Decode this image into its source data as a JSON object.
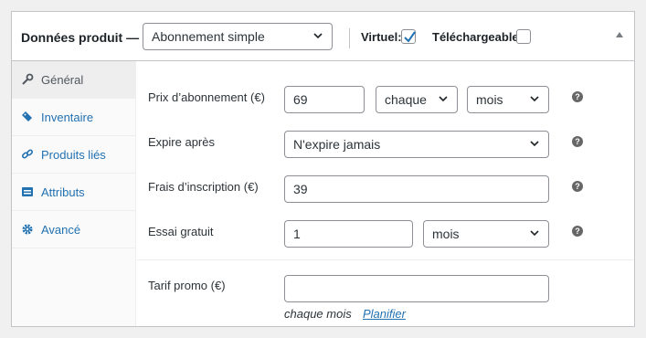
{
  "header": {
    "title": "Données produit —",
    "product_type": "Abonnement simple",
    "virtual_label": "Virtuel:",
    "virtual_checked": true,
    "downloadable_label": "Téléchargeable:",
    "downloadable_checked": false,
    "toggle_icon": "triangle-up-icon"
  },
  "tabs": [
    {
      "label": "Général",
      "icon": "wrench-icon",
      "active": true
    },
    {
      "label": "Inventaire",
      "icon": "tag-icon",
      "active": false
    },
    {
      "label": "Produits liés",
      "icon": "link-icon",
      "active": false
    },
    {
      "label": "Attributs",
      "icon": "list-icon",
      "active": false
    },
    {
      "label": "Avancé",
      "icon": "gear-icon",
      "active": false
    }
  ],
  "fields": {
    "subscription_price": {
      "label": "Prix d’abonnement (€)",
      "value": "69",
      "interval": "chaque",
      "period": "mois"
    },
    "expire": {
      "label": "Expire après",
      "value": "N'expire jamais"
    },
    "signup_fee": {
      "label": "Frais d’inscription (€)",
      "value": "39"
    },
    "trial": {
      "label": "Essai gratuit",
      "value": "1",
      "period": "mois"
    },
    "sale_price": {
      "label": "Tarif promo (€)",
      "value": "",
      "hint": "chaque mois",
      "schedule_link": "Planifier"
    }
  },
  "help_glyph": "?",
  "colors": {
    "accent": "#2271b1",
    "border": "#8c8f94",
    "active_tab_bg": "#eeeeee"
  }
}
